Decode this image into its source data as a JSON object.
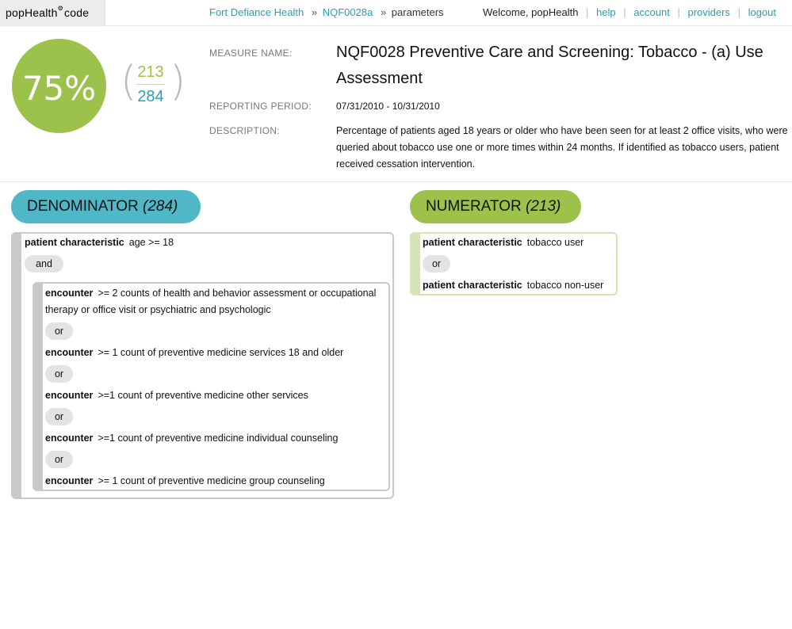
{
  "logo": {
    "text": "popHealth",
    "suffix": "code"
  },
  "breadcrumb": {
    "org": "Fort Defiance Health",
    "measure": "NQF0028a",
    "current": "parameters",
    "separator": "»"
  },
  "user_nav": {
    "welcome": "Welcome, popHealth",
    "help": "help",
    "account": "account",
    "providers": "providers",
    "logout": "logout",
    "separator": "|"
  },
  "score": {
    "percent": "75%",
    "numerator": "213",
    "denominator": "284",
    "open_paren": "(",
    "close_paren": ")"
  },
  "measure": {
    "name_label": "MEASURE NAME:",
    "name": "NQF0028 Preventive Care and Screening: Tobacco - (a) Use Assessment",
    "period_label": "REPORTING PERIOD:",
    "period": "07/31/2010 - 10/31/2010",
    "description_label": "DESCRIPTION:",
    "description": "Percentage of patients aged 18 years or older who have been seen for at least 2 office visits, who were queried about tobacco use one or more times within 24 months. If identified as tobacco users, patient received cessation intervention."
  },
  "denominator": {
    "label": "DENOMINATOR",
    "count": "(284)",
    "criterion": {
      "type": "patient characteristic",
      "text": "age >= 18"
    },
    "operator": "and",
    "encounters": [
      {
        "type": "encounter",
        "text": ">= 2 counts of health and behavior assessment or occupational therapy or office visit or psychiatric and psychologic"
      },
      {
        "type": "encounter",
        "text": ">= 1 count of preventive medicine services 18 and older"
      },
      {
        "type": "encounter",
        "text": ">=1 count of preventive medicine other services"
      },
      {
        "type": "encounter",
        "text": ">=1 count of preventive medicine individual counseling"
      },
      {
        "type": "encounter",
        "text": ">= 1 count of preventive medicine group counseling"
      }
    ],
    "encounter_operator": "or"
  },
  "numerator": {
    "label": "NUMERATOR",
    "count": "(213)",
    "criteria": [
      {
        "type": "patient characteristic",
        "text": "tobacco user"
      },
      {
        "type": "patient characteristic",
        "text": "tobacco non-user"
      }
    ],
    "operator": "or"
  },
  "colors": {
    "green": "#9cc24b",
    "teal": "#2aa1b3",
    "pill_teal": "#4fb7c6",
    "gray_border": "#c9c9c9",
    "light_green_border": "#d5e4b3"
  }
}
